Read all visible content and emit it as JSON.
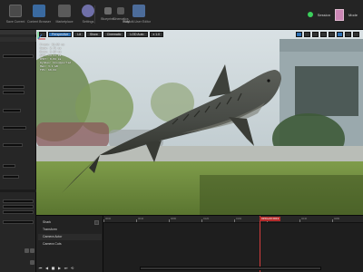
{
  "toolbar": {
    "items": [
      {
        "label": "Save Current"
      },
      {
        "label": "Content Browser"
      },
      {
        "label": "Marketplace"
      },
      {
        "label": "Settings"
      },
      {
        "label": "Blueprints"
      },
      {
        "label": "Cinematics"
      },
      {
        "label": "Build"
      },
      {
        "label": "Play"
      },
      {
        "label": "Multi-User Editor"
      }
    ],
    "status_label": "Session",
    "mode_label": "Mode"
  },
  "viewport": {
    "buttons": [
      "Perspective",
      "Lit",
      "Show",
      "Cinematic",
      "LOD Auto",
      "x 1.0"
    ],
    "stats_lines": [
      "Frame: 16.66 ms",
      "Game: 2.71 ms",
      "Draw: 3.04 ms",
      "GPU: 14.21 ms",
      "RHIT: 0.82 ms",
      "DynRes: Unsupported",
      "Mem: 3.1 GB",
      "FPS: 60.02"
    ]
  },
  "sequencer": {
    "tracks": [
      {
        "label": "Shark"
      },
      {
        "label": "  Transform"
      },
      {
        "label": "Camera Actor"
      },
      {
        "label": "Camera Cuts"
      }
    ],
    "playhead_label": "0153+00 0019",
    "ruler_ticks": [
      "0000",
      "0040",
      "0080",
      "0120",
      "0160",
      "0200",
      "0240",
      "0280"
    ],
    "transport": [
      "⏮",
      "◀",
      "■",
      "▶",
      "⏭",
      "⟲"
    ]
  },
  "colors": {
    "accent": "#2d6fb2",
    "status": "#3bd05c",
    "playhead": "#d33d3d",
    "swatch": "#cc87b6"
  }
}
